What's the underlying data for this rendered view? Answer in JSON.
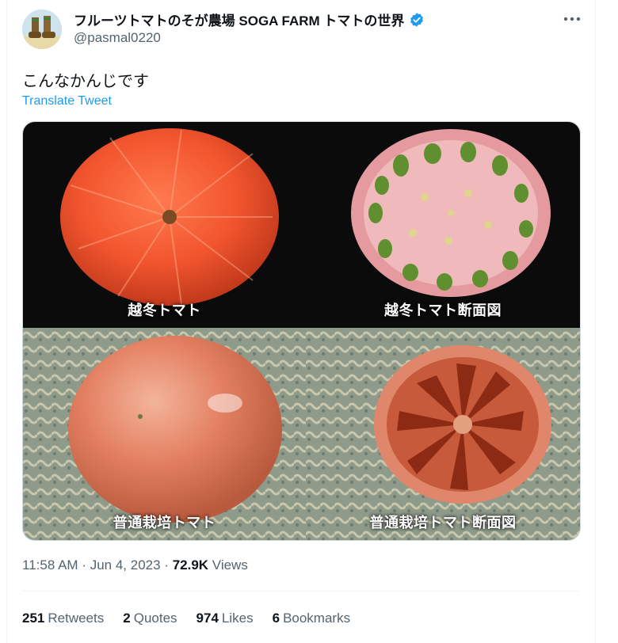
{
  "author": {
    "display_name": "フルーツトマトのそが農場 SOGA FARM トマトの世界",
    "handle": "@pasmal0220",
    "verified": true
  },
  "tweet": {
    "text": "こんなかんじです",
    "translate_label": "Translate Tweet"
  },
  "media": {
    "captions": [
      "越冬トマト",
      "越冬トマト断面図",
      "普通栽培トマト",
      "普通栽培トマト断面図"
    ]
  },
  "meta": {
    "time": "11:58 AM",
    "date": "Jun 4, 2023",
    "views_count": "72.9K",
    "views_label": "Views"
  },
  "stats": {
    "retweets": {
      "count": "251",
      "label": "Retweets"
    },
    "quotes": {
      "count": "2",
      "label": "Quotes"
    },
    "likes": {
      "count": "974",
      "label": "Likes"
    },
    "bookmarks": {
      "count": "6",
      "label": "Bookmarks"
    }
  },
  "colors": {
    "accent": "#1d9bf0",
    "secondary_text": "#536471",
    "primary_text": "#0f1419"
  },
  "icons": [
    "avatar-boots-icon",
    "verified-badge-icon",
    "more-options-icon"
  ]
}
